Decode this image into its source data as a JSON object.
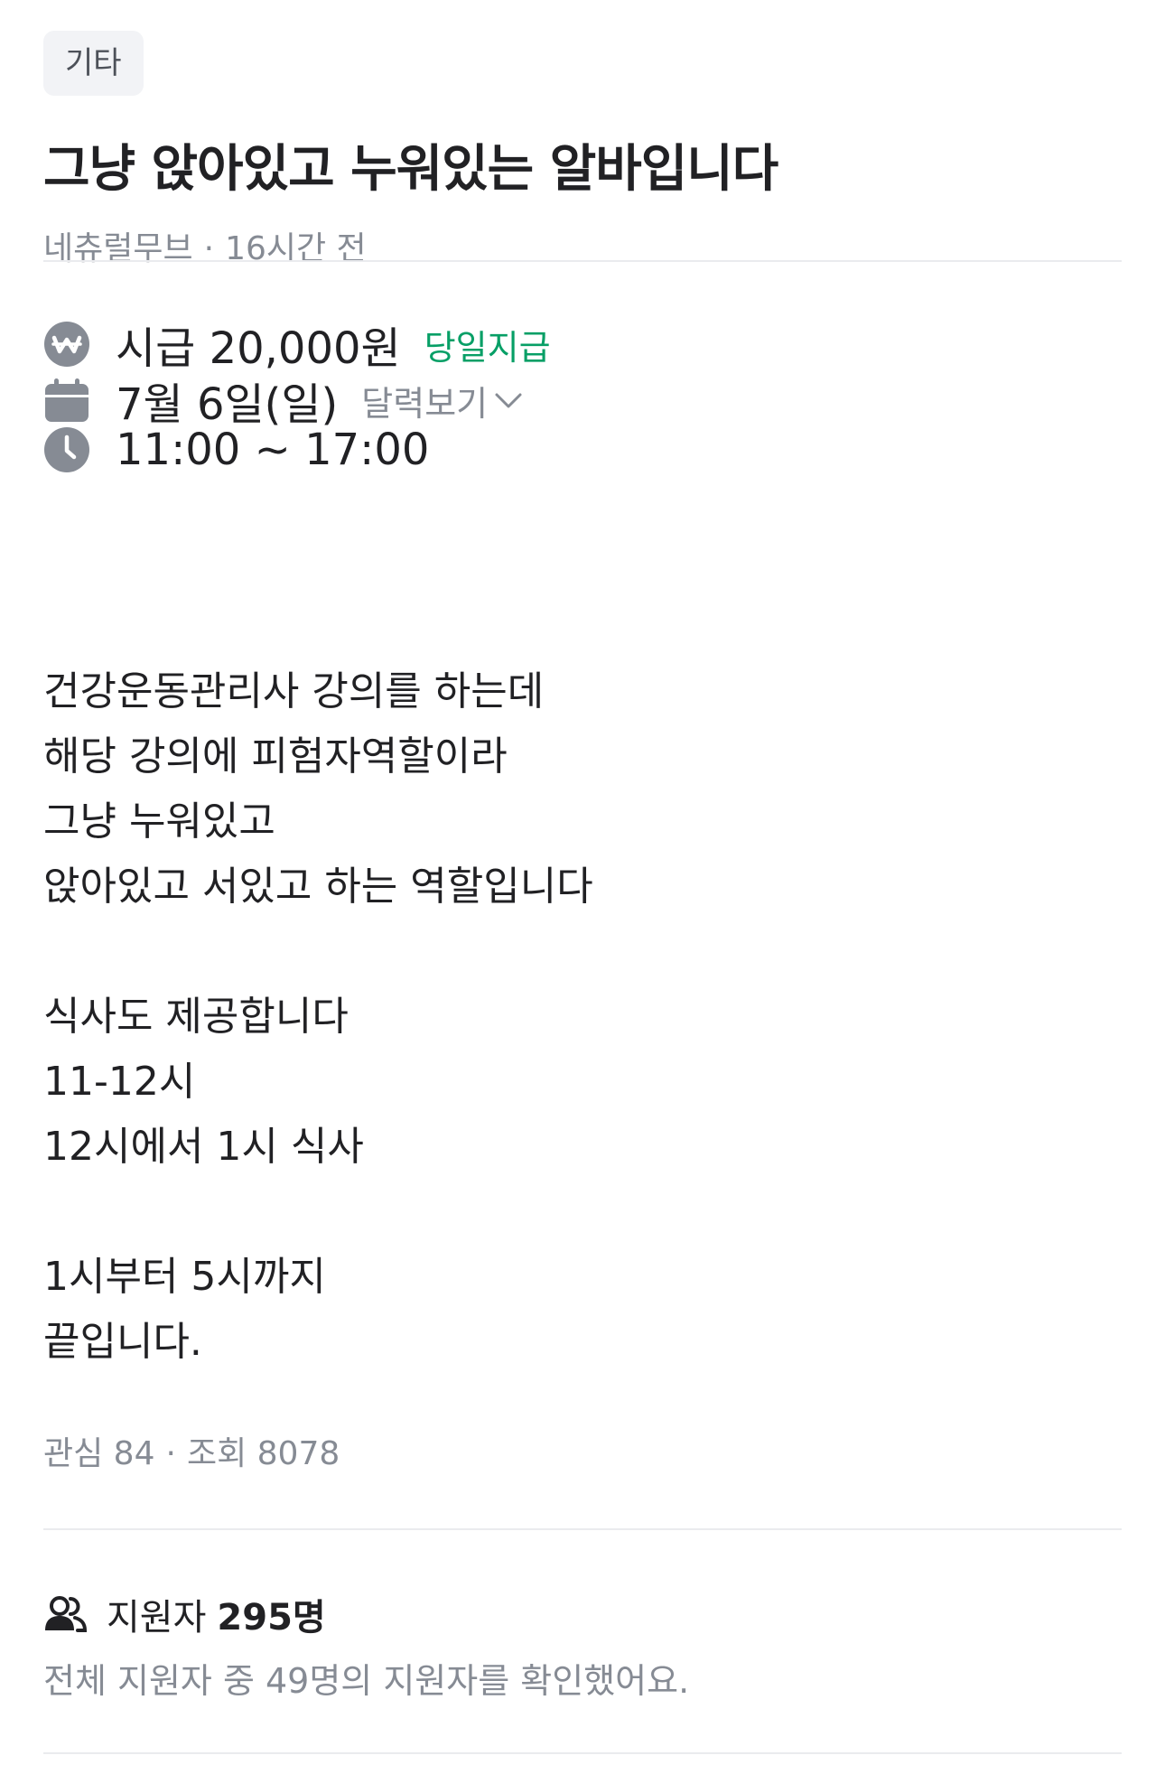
{
  "category": "기타",
  "title": "그냥 앉아있고 누워있는 알바입니다",
  "meta": {
    "author": "네츄럴무브",
    "separator": "·",
    "posted": "16시간 전"
  },
  "info": {
    "wage": {
      "icon": "won-icon",
      "text": "시급 20,000원",
      "badge": "당일지급"
    },
    "date": {
      "icon": "calendar-icon",
      "text": "7월 6일(일)",
      "link": "달력보기"
    },
    "time": {
      "icon": "clock-icon",
      "text": "11:00 ~ 17:00"
    }
  },
  "description": "건강운동관리사 강의를 하는데\n해당 강의에 피험자역할이라\n그냥 누워있고\n앉아있고 서있고 하는 역할입니다\n\n식사도 제공합니다\n11-12시\n12시에서 1시 식사\n\n1시부터 5시까지\n끝입니다.",
  "stats": {
    "interest": "관심 84",
    "separator": "·",
    "views": "조회 8078"
  },
  "applicants": {
    "icon": "people-icon",
    "label": "지원자",
    "count": "295명",
    "summary": "전체 지원자 중 49명의 지원자를 확인했어요."
  },
  "colors": {
    "accent_green": "#079f66",
    "text_primary": "#212124",
    "text_secondary": "#868b94",
    "icon_grey": "#868b94",
    "chip_bg": "#f2f3f6",
    "divider": "#eaebee"
  }
}
